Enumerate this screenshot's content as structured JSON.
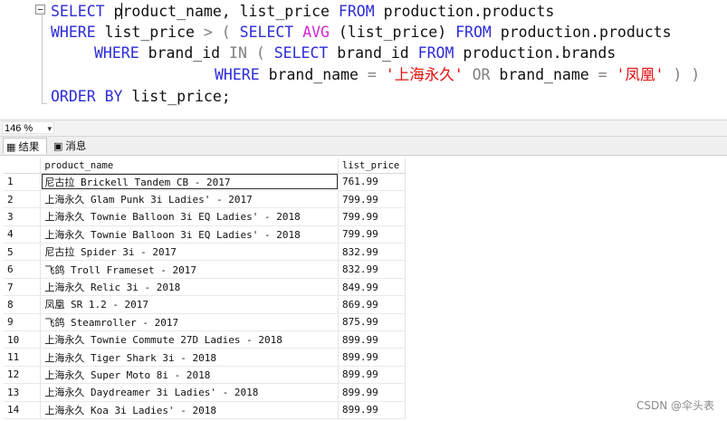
{
  "editor": {
    "line1": {
      "kw_select": "SELECT",
      "text1": " product_name, list_price ",
      "kw_from": "FROM",
      "text2": " production.products"
    },
    "line2": {
      "kw_where": "WHERE",
      "text1": " list_price ",
      "op_gt": ">",
      "text2": " ( ",
      "kw_select": "SELECT",
      "text3": " ",
      "fn_avg": "AVG",
      "text4": " (list_price) ",
      "kw_from": "FROM",
      "text5": " production.products"
    },
    "line3": {
      "kw_where": "WHERE",
      "text1": " brand_id ",
      "op_in": "IN",
      "text2": " ( ",
      "kw_select": "SELECT",
      "text3": " brand_id ",
      "kw_from": "FROM",
      "text4": " production.brands"
    },
    "line4": {
      "kw_where": "WHERE",
      "text1": " brand_name ",
      "op_eq": "=",
      "text2": " ",
      "str1": "'上海永久'",
      "text3": " ",
      "op_or": "OR",
      "text4": " brand_name ",
      "op_eq2": "=",
      "text5": " ",
      "str2": "'凤凰'",
      "text6": " ",
      "op_close": ") )"
    },
    "line5": {
      "kw_order": "ORDER BY",
      "text1": " list_price;"
    }
  },
  "zoom": {
    "value": "146 %",
    "arrow": "▾"
  },
  "tabs": [
    {
      "label": "结果",
      "icon": "grid-icon"
    },
    {
      "label": "消息",
      "icon": "message-icon"
    }
  ],
  "grid": {
    "columns": [
      "product_name",
      "list_price"
    ],
    "rows": [
      [
        "1",
        "尼古拉 Brickell Tandem CB - 2017",
        "761.99"
      ],
      [
        "2",
        "上海永久 Glam Punk 3i Ladies' - 2017",
        "799.99"
      ],
      [
        "3",
        "上海永久 Townie Balloon 3i EQ Ladies' - 2018",
        "799.99"
      ],
      [
        "4",
        "上海永久 Townie Balloon 3i EQ Ladies' - 2018",
        "799.99"
      ],
      [
        "5",
        "尼古拉 Spider 3i - 2017",
        "832.99"
      ],
      [
        "6",
        "飞鸽 Troll Frameset - 2017",
        "832.99"
      ],
      [
        "7",
        "上海永久 Relic 3i - 2018",
        "849.99"
      ],
      [
        "8",
        "凤凰 SR 1.2 - 2017",
        "869.99"
      ],
      [
        "9",
        "飞鸽 Steamroller - 2017",
        "875.99"
      ],
      [
        "10",
        "上海永久 Townie Commute 27D Ladies - 2018",
        "899.99"
      ],
      [
        "11",
        "上海永久 Tiger Shark 3i - 2018",
        "899.99"
      ],
      [
        "12",
        "上海永久 Super Moto 8i - 2018",
        "899.99"
      ],
      [
        "13",
        "上海永久 Daydreamer 3i Ladies' - 2018",
        "899.99"
      ],
      [
        "14",
        "上海永久 Koa 3i Ladies' - 2018",
        "899.99"
      ]
    ]
  },
  "watermark": "CSDN @伞头表"
}
